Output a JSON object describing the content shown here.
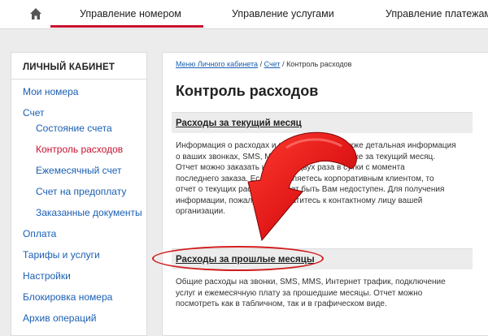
{
  "nav": {
    "home_icon": "home-icon",
    "tabs": [
      "Управление номером",
      "Управление услугами",
      "Управление платежами"
    ],
    "accent": "#c8102e"
  },
  "sidebar": {
    "title": "ЛИЧНЫЙ КАБИНЕТ",
    "items": [
      {
        "label": "Мои номера"
      },
      {
        "label": "Счет"
      },
      {
        "label": "Состояние счета"
      },
      {
        "label": "Контроль расходов"
      },
      {
        "label": "Ежемесячный счет"
      },
      {
        "label": "Счет на предоплату"
      },
      {
        "label": "Заказанные документы"
      },
      {
        "label": "Оплата"
      },
      {
        "label": "Тарифы и услуги"
      },
      {
        "label": "Настройки"
      },
      {
        "label": "Блокировка номера"
      },
      {
        "label": "Архив операций"
      }
    ]
  },
  "main": {
    "breadcrumb": [
      "Меню Личного кабинета",
      "Счет",
      "Контроль расходов"
    ],
    "breadcrumb_sep": "/",
    "title": "Контроль расходов",
    "sections": [
      {
        "heading": "Расходы за текущий месяц",
        "lines": [
          "Информация о расходах и поступлениях, а также детальная информация",
          "о ваших звонках, SMS, MMS и Интернет-трафике за текущий месяц.",
          "Отчет можно заказать не более двух раза в сутки с момента",
          "последнего заказа. Если вы являетесь корпоративным клиентом, то",
          "отчет о текущих расходах может быть Вам недоступен. Для получения",
          "информации, пожалуйста, обратитесь к контактному лицу вашей",
          "организации."
        ]
      },
      {
        "heading": "Расходы за прошлые месяцы",
        "lines": [
          "Общие расходы на звонки, SMS, MMS, Интернет трафик, подключение",
          "услуг и ежемесячную плату за прошедшие месяцы. Отчет можно",
          "посмотреть как в табличном, так и в графическом виде."
        ]
      }
    ]
  },
  "annotation": {
    "color": "#d11b1b"
  }
}
